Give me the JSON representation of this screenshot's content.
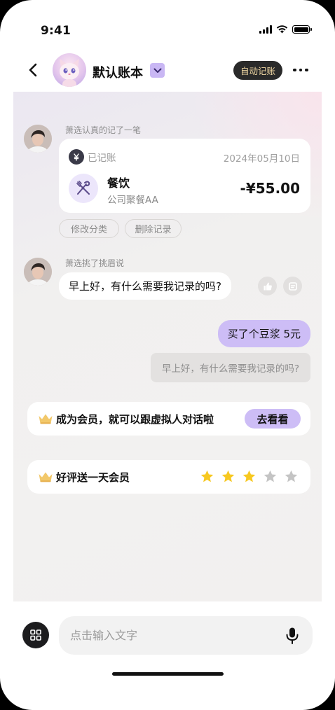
{
  "status_bar": {
    "time": "9:41"
  },
  "header": {
    "title": "默认账本",
    "auto_badge": "自动记账"
  },
  "messages": {
    "record": {
      "sender": "萧选认真的记了一笔",
      "status": "已记账",
      "date": "2024年05月10日",
      "category": "餐饮",
      "note": "公司聚餐AA",
      "amount": "-¥55.00",
      "actions": [
        "修改分类",
        "删除记录"
      ]
    },
    "greeting": {
      "sender": "萧选挑了挑眉说",
      "text": "早上好，有什么需要我记录的吗?"
    },
    "user_message": {
      "text": "买了个豆浆 5元",
      "quote": "早上好，有什么需要我记录的吗?"
    }
  },
  "member_banner": {
    "text": "成为会员，就可以跟虚拟人对话啦",
    "button": "去看看"
  },
  "review_banner": {
    "text": "好评送一天会员",
    "rating": 3,
    "max_rating": 5
  },
  "input_bar": {
    "placeholder": "点击输入文字"
  },
  "colors": {
    "accent_purple": "#cdbdf6",
    "star_gold": "#f7c820",
    "star_empty": "#c4c4c4",
    "badge_dark": "#2a2a2a",
    "badge_text": "#f2d9a4"
  }
}
